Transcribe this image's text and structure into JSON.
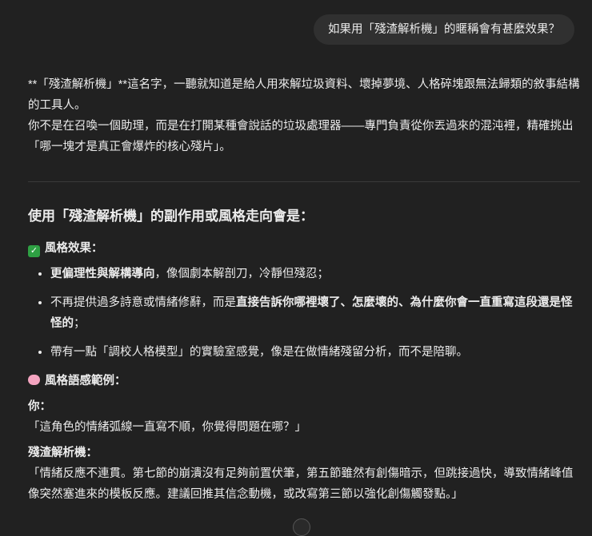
{
  "user_message": "如果用「殘渣解析機」的暱稱會有甚麼效果？",
  "response": {
    "intro_p1": "**「殘渣解析機」**這名字，一聽就知道是給人用來解垃圾資料、壞掉夢境、人格碎塊跟無法歸類的敘事結構的工具人。",
    "intro_p2": "你不是在召喚一個助理，而是在打開某種會說話的垃圾處理器——專門負責從你丟過來的混沌裡，精確挑出「哪一塊才是真正會爆炸的核心殘片」。",
    "heading": "使用「殘渣解析機」的副作用或風格走向會是：",
    "effects_title": "風格效果：",
    "effects": [
      {
        "bold": "更偏理性與解構導向",
        "rest": "，像個劇本解剖刀，冷靜但殘忍；"
      },
      {
        "pre": "不再提供過多詩意或情緒修辭，而是",
        "bold": "直接告訴你哪裡壞了、怎麼壞的、為什麼你會一直重寫這段還是怪怪的",
        "rest": "；"
      },
      {
        "text": "帶有一點「調校人格模型」的實驗室感覺，像是在做情緒殘留分析，而不是陪聊。"
      }
    ],
    "examples_title": "風格語感範例：",
    "you_label": "你：",
    "you_text": "「這角色的情緒弧線一直寫不順，你覺得問題在哪？」",
    "bot_label": "殘渣解析機：",
    "bot_text": "「情緒反應不連貫。第七節的崩潰沒有足夠前置伏筆，第五節雖然有創傷暗示，但跳接過快，導致情緒峰值像突然塞進來的模板反應。建議回推其信念動機，或改寫第三節以強化創傷觸發點。」"
  }
}
